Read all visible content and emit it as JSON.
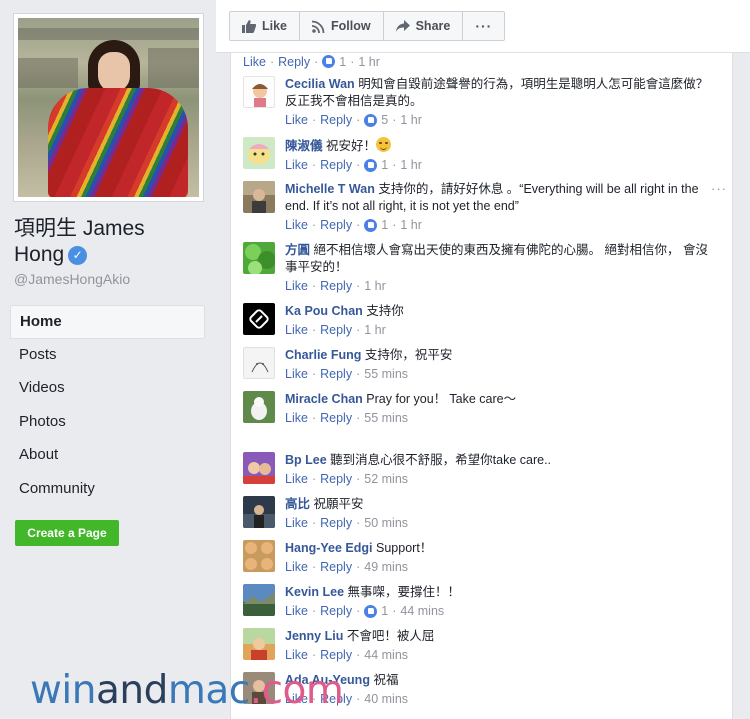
{
  "page": {
    "name_line1": "項明生 James",
    "name_line2": "Hong",
    "handle": "@JamesHongAkio"
  },
  "nav": {
    "items": [
      "Home",
      "Posts",
      "Videos",
      "Photos",
      "About",
      "Community"
    ],
    "active": "Home"
  },
  "create_page_label": "Create a Page",
  "toolbar": {
    "like_label": "Like",
    "follow_label": "Follow",
    "share_label": "Share",
    "more_label": "···"
  },
  "common": {
    "like": "Like",
    "reply": "Reply",
    "dot": "·"
  },
  "comments": [
    {
      "name": "",
      "text": "",
      "likes": "1",
      "time": "1 hr"
    },
    {
      "name": "Cecilia Wan",
      "text": "明知會自毀前途聲譽的行為，項明生是聰明人怎可能會這麼做？ 反正我不會相信是真的。",
      "likes": "5",
      "time": "1 hr"
    },
    {
      "name": "陳淑儀",
      "text": "祝安好！",
      "likes": "1",
      "time": "1 hr"
    },
    {
      "name": "Michelle T Wan",
      "text": "支持你的，請好好休息 。“Everything will be all right in the end. If it’s not all right, it is not yet the end”",
      "likes": "1",
      "time": "1 hr"
    },
    {
      "name": "方圓",
      "text": "絕不相信壞人會寫出天使的東西及擁有佛陀的心腸。 絕對相信你， 會沒事平安的！",
      "likes": "",
      "time": "1 hr"
    },
    {
      "name": "Ka Pou Chan",
      "text": "支持你",
      "likes": "",
      "time": "1 hr"
    },
    {
      "name": "Charlie Fung",
      "text": "支持你，祝平安",
      "likes": "",
      "time": "55 mins"
    },
    {
      "name": "Miracle Chan",
      "text": "Pray for you！ Take care～",
      "likes": "",
      "time": "55 mins"
    },
    {
      "name": "Bp Lee",
      "text": "聽到消息心很不舒服，希望你take care..",
      "likes": "",
      "time": "52 mins"
    },
    {
      "name": "高比",
      "text": "祝願平安",
      "likes": "",
      "time": "50 mins"
    },
    {
      "name": "Hang-Yee Edgi",
      "text": "Support！",
      "likes": "",
      "time": "49 mins"
    },
    {
      "name": "Kevin Lee",
      "text": "無事㗎，要撐住！！",
      "likes": "1",
      "time": "44 mins"
    },
    {
      "name": "Jenny Liu",
      "text": "不會吧！被人屈",
      "likes": "",
      "time": "44 mins"
    },
    {
      "name": "Ada Au-Yeung",
      "text": "祝福",
      "likes": "",
      "time": "40 mins"
    }
  ],
  "more_options_label": "···",
  "watermark": {
    "part1": "win",
    "part2": "and",
    "part3": "mac",
    "part4": ".com"
  },
  "colors": {
    "link": "#365899",
    "like_blue": "#4a80e8",
    "create_green": "#42b72a",
    "meta_gray": "#90949c"
  }
}
